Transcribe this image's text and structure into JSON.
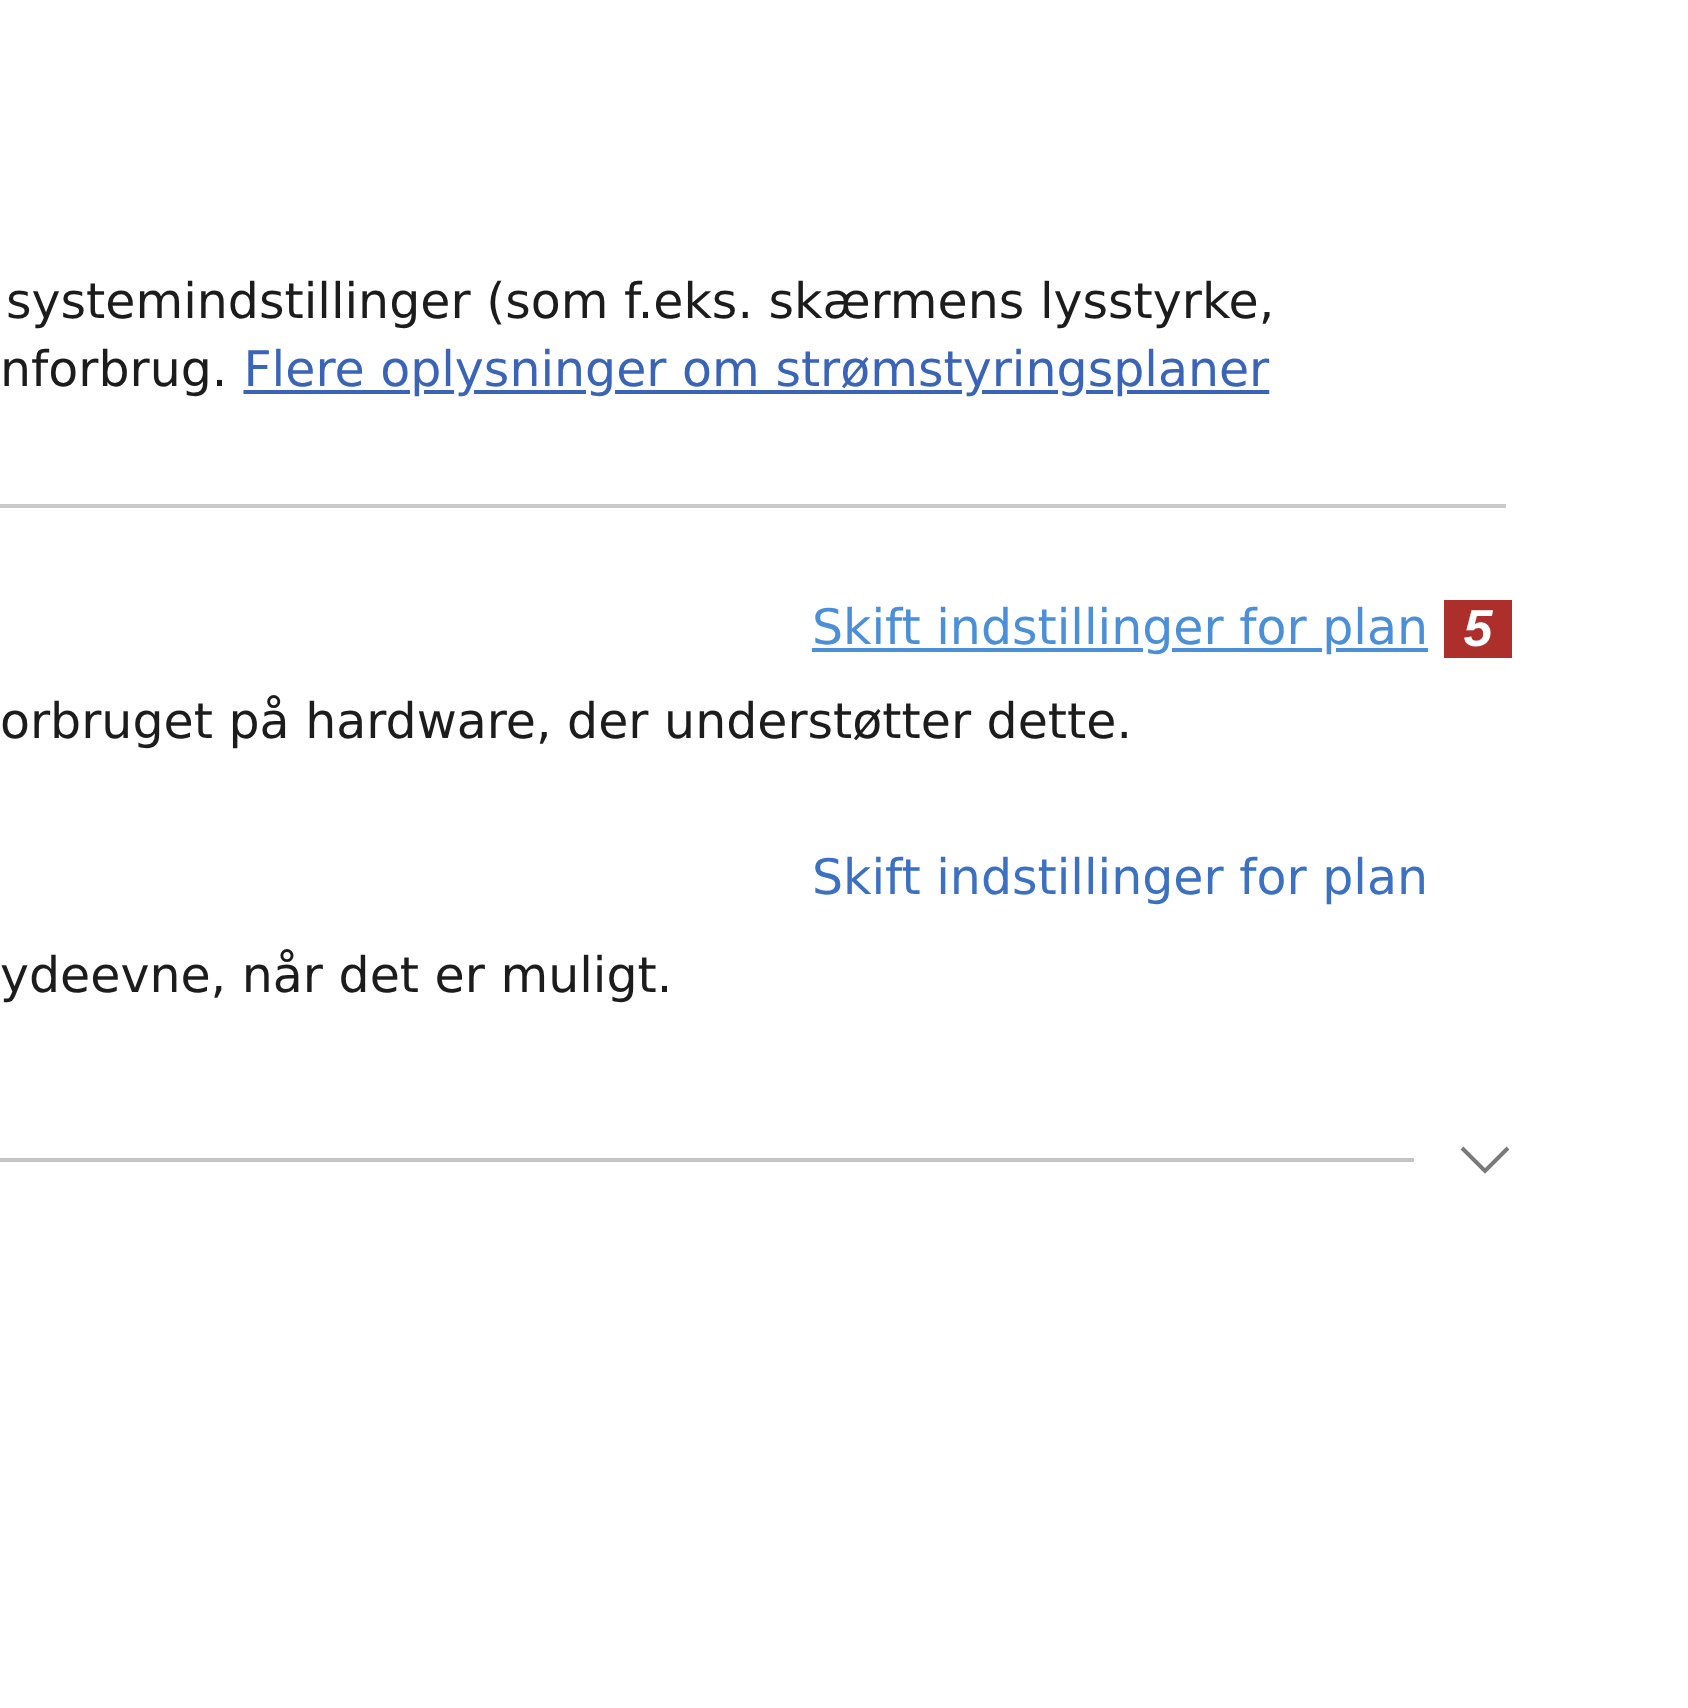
{
  "intro": {
    "line_1": "systemindstillinger (som f.eks. skærmens lysstyrke,",
    "line_2": "nforbrug.",
    "link": "Flere oplysninger om strømstyringsplaner"
  },
  "plans": [
    {
      "link": "Skift indstillinger for plan",
      "hovered": true,
      "callout": "5",
      "description": "orbruget på hardware, der understøtter dette."
    },
    {
      "link": "Skift indstillinger for plan",
      "hovered": false,
      "description": "ydeevne, når det er muligt."
    }
  ],
  "more_plans": {
    "expanded": false
  }
}
